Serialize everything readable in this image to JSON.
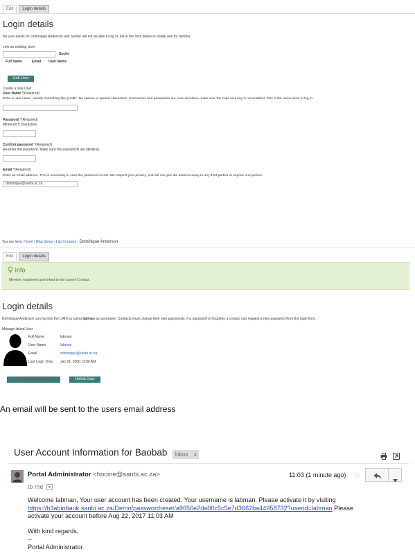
{
  "top_form": {
    "tabs": [
      "Edit",
      "Login details"
    ],
    "title": "Login details",
    "notice": "No user exists for Dominique Anderson and he/she will not be able to log in. Fill in the form below to create one for him/her.",
    "link_existing_label": "Link an existing User",
    "search_button": "Suche",
    "search_value": "",
    "columns": [
      "Full Name",
      "Email",
      "User Name"
    ],
    "link_user_button": "Link User",
    "create_new_label": "Create a new User",
    "username": {
      "label": "User Name",
      "required": "*(Required)",
      "help": "Enter a user name, usually something like 'jsmith'. No spaces or special characters. Usernames and passwords are case sensitive, make sure the caps lock key is not enabled. This is the name used to log in.",
      "value": ""
    },
    "password": {
      "label": "Password",
      "required": "*(Required)",
      "help": "Minimum 5 characters.",
      "value": ""
    },
    "confirm_password": {
      "label": "Confirm password",
      "required": "*(Required)",
      "help": "Re-enter the password. Make sure the passwords are identical.",
      "value": ""
    },
    "email": {
      "label": "Email",
      "required": "*(Required)",
      "help": "Enter an email address. This is necessary in case the password is lost. We respect your privacy, and will not give the address away to any third parties or expose it anywhere.",
      "value": "dominique@sanbi.ac.za"
    }
  },
  "second_page": {
    "breadcrumb_prefix": "You are here:",
    "breadcrumb": [
      "Home",
      "Bika Setup",
      "Lab Contacts"
    ],
    "breadcrumb_current": "Dominique Anderson",
    "tabs": [
      "Edit",
      "Login details"
    ],
    "info_title": "Info",
    "info_message": "Member registered and linked to the current Contact.",
    "title": "Login details",
    "description_pre": "Dominique Anderson can log into the LIMS by using ",
    "description_user": "labman",
    "description_post": " as username. Contacts must change their own passwords. If a password is forgotten a contact can request a new password from the login form.",
    "manage_label": "Manage linked User",
    "fields": [
      {
        "label": "Full Name",
        "value": "labman"
      },
      {
        "label": "User Name",
        "value": "labman"
      },
      {
        "label": "Email",
        "value": "dominique@sanbi.ac.za"
      },
      {
        "label": "Last Login Time",
        "value": "Jan 01, 2000 12:00 AM"
      }
    ],
    "button_left": "Link to another user",
    "unlink_button": "Unlink User"
  },
  "caption": "An email will be sent to the users email address",
  "email": {
    "subject": "User Account Information for Baobab",
    "label_chip": "Inbox",
    "chip_close": "x",
    "sender_name": "Portal Administrator",
    "sender_email": "<hocine@sanbi.ac.za>",
    "time": "11:03 (1 minute ago)",
    "to": "to me",
    "body_1": "Welcome labman, Your user account has been created. Your username is labman. Please activate it by visiting",
    "link": "https://b3abiobank.sanbi.ac.za/Demo/passwordreset/a9656e2da00c5c5e7d3662ba44958732?userid=labman",
    "body_2": "Please",
    "body_3": "activate your account before Aug 22, 2017 11:03 AM",
    "regards": "With kind regards,",
    "dashes": "--",
    "signature": "Portal Administrator"
  }
}
